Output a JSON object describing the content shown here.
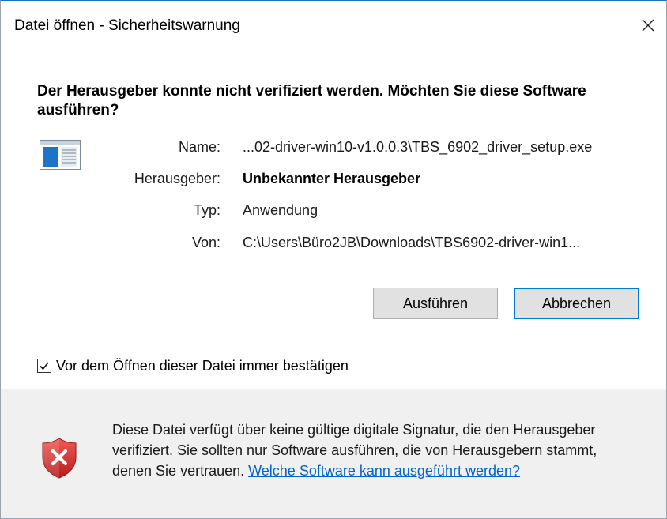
{
  "window": {
    "title": "Datei öffnen - Sicherheitswarnung",
    "close_icon": "close-icon"
  },
  "headline": "Der Herausgeber konnte nicht verifiziert werden. Möchten Sie diese Software ausführen?",
  "file_icon": "application-window-icon",
  "details": {
    "name_label": "Name:",
    "name_value": "...02-driver-win10-v1.0.0.3\\TBS_6902_driver_setup.exe",
    "publisher_label": "Herausgeber:",
    "publisher_value": "Unbekannter Herausgeber",
    "type_label": "Typ:",
    "type_value": "Anwendung",
    "from_label": "Von:",
    "from_value": "C:\\Users\\Büro2JB\\Downloads\\TBS6902-driver-win1..."
  },
  "buttons": {
    "run_label": "Ausführen",
    "cancel_label": "Abbrechen"
  },
  "checkbox": {
    "label": "Vor dem Öffnen dieser Datei immer bestätigen",
    "checked": true
  },
  "footer": {
    "icon": "shield-error-icon",
    "text": "Diese Datei verfügt über keine gültige digitale Signatur, die den Herausgeber verifiziert. Sie sollten nur Software ausführen, die von Herausgebern stammt, denen Sie vertrauen. ",
    "link_text": "Welche Software kann ausgeführt werden?"
  },
  "colors": {
    "accent": "#0078d7",
    "link": "#0066cc",
    "footer_bg": "#f0f0f0",
    "shield_red": "#d9302c"
  }
}
